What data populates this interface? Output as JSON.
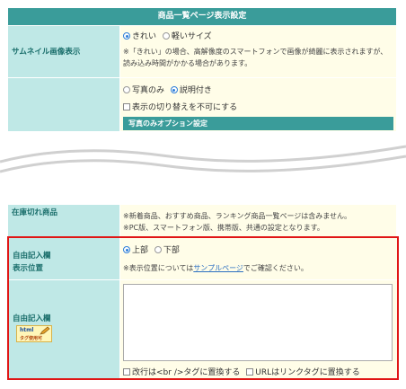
{
  "header": {
    "title": "商品一覧ページ表示設定"
  },
  "thumbnail": {
    "label": "サムネイル画像表示",
    "options": [
      "きれい",
      "軽いサイズ"
    ],
    "note": "※「きれい」の場合、高解像度のスマートフォンで画像が綺麗に表示されますが、読み込み時間がかかる場合があります。"
  },
  "display": {
    "options": [
      "写真のみ",
      "説明付き"
    ],
    "disable_toggle": "表示の切り替えを不可にする",
    "subheader": "写真のみオプション設定"
  },
  "soldout": {
    "label": "在庫切れ商品",
    "note_line1": "※新着商品、おすすめ商品、ランキング商品一覧ページは含みません。",
    "note_line2": "※PC版、スマートフォン版、携帯版、共通の設定となります。"
  },
  "free_position": {
    "label_line1": "自由記入欄",
    "label_line2": "表示位置",
    "options": [
      "上部",
      "下部"
    ],
    "note_prefix": "※表示位置については",
    "note_link": "サンプルページ",
    "note_suffix": "でご確認ください。"
  },
  "free_text": {
    "label": "自由記入欄",
    "badge_top": "html",
    "badge_bottom": "タグ使用可",
    "textarea_value": "",
    "option_br": "改行は<br />タグに置換する",
    "option_url": "URLはリンクタグに置換する"
  },
  "colors": {
    "header": "#3a9c9a",
    "label_bg": "#bfe8e6",
    "cell_bg": "#fffde8",
    "highlight": "#e01515"
  }
}
